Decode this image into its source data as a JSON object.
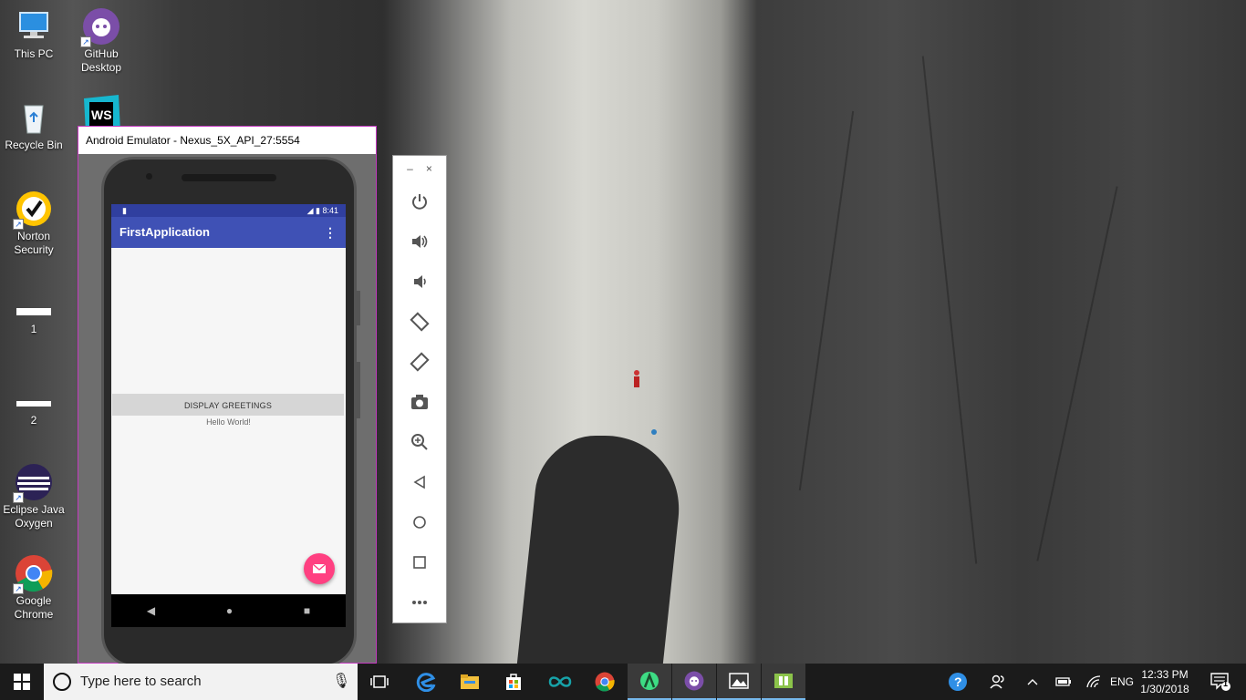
{
  "desktop": {
    "icons": [
      {
        "label": "This PC",
        "icon": "computer-icon"
      },
      {
        "label": "GitHub\nDesktop",
        "icon": "github-icon"
      },
      {
        "label": "Recycle Bin",
        "icon": "recycle-bin-icon"
      },
      {
        "label": "WS",
        "icon": "webstorm-icon"
      },
      {
        "label": "Norton\nSecurity",
        "icon": "norton-icon"
      },
      {
        "label": "1",
        "icon": "file-icon"
      },
      {
        "label": "2",
        "icon": "file-icon"
      },
      {
        "label": "Eclipse Java\nOxygen",
        "icon": "eclipse-icon"
      },
      {
        "label": "Google\nChrome",
        "icon": "chrome-icon"
      }
    ]
  },
  "emulator": {
    "window_title": "Android Emulator - Nexus_5X_API_27:5554",
    "status_time": "8:41",
    "app_title": "FirstApplication",
    "button_label": "DISPLAY GREETINGS",
    "hello_text": "Hello World!",
    "colors": {
      "primary": "#3f51b5",
      "primary_dark": "#303f9f",
      "accent": "#ff4081"
    }
  },
  "toolbar": {
    "minimize": "–",
    "close": "×",
    "tools": [
      "power-icon",
      "volume-up-icon",
      "volume-down-icon",
      "rotate-left-icon",
      "rotate-right-icon",
      "camera-icon",
      "zoom-icon",
      "back-icon",
      "home-icon",
      "overview-icon",
      "more-icon"
    ]
  },
  "taskbar": {
    "search_placeholder": "Type here to search",
    "language": "ENG",
    "time": "12:33 PM",
    "date": "1/30/2018",
    "notification_count": "1"
  }
}
